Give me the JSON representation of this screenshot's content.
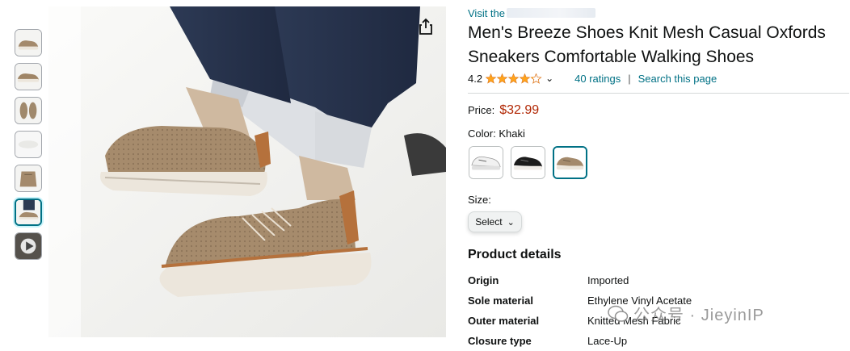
{
  "store_link": "Visit the",
  "product": {
    "title": "Men's Breeze Shoes Knit Mesh Casual Oxfords Sneakers Comfortable Walking Shoes",
    "rating": "4.2",
    "ratings_link": "40 ratings",
    "search_link": "Search this page",
    "separator": "|"
  },
  "price": {
    "label": "Price:",
    "value": "$32.99"
  },
  "color": {
    "label": "Color:",
    "value": "Khaki",
    "swatches": [
      "white",
      "black",
      "khaki"
    ],
    "selected": "khaki"
  },
  "size": {
    "label": "Size:",
    "select_label": "Select"
  },
  "details": {
    "title": "Product details",
    "rows": [
      {
        "key": "Origin",
        "value": "Imported"
      },
      {
        "key": "Sole material",
        "value": "Ethylene Vinyl Acetate"
      },
      {
        "key": "Outer material",
        "value": "Knitted Mesh Fabric"
      },
      {
        "key": "Closure type",
        "value": "Lace-Up"
      }
    ]
  },
  "watermark": "公众号 · JieyinIP",
  "colors": {
    "link": "#007185",
    "price": "#b12704",
    "star": "#ffa41c",
    "selected_border": "#007185"
  },
  "icons": [
    "share-icon",
    "star-icon",
    "chevron-down-icon",
    "play-icon"
  ]
}
